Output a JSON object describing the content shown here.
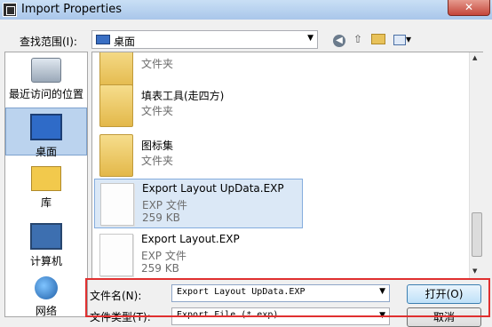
{
  "window": {
    "title": "Import Properties",
    "close_label": "✕"
  },
  "lookin": {
    "label": "查找范围(I):",
    "value": "桌面"
  },
  "toolbar": {
    "back_icon": "back-arrow-icon",
    "up_icon": "up-folder-icon",
    "new_icon": "new-folder-icon",
    "views_icon": "views-menu-icon"
  },
  "places": [
    {
      "label": "最近访问的位置",
      "icon": "recent-places-icon"
    },
    {
      "label": "桌面",
      "icon": "desktop-icon",
      "selected": true
    },
    {
      "label": "库",
      "icon": "libraries-icon"
    },
    {
      "label": "计算机",
      "icon": "computer-icon"
    },
    {
      "label": "网络",
      "icon": "network-icon"
    }
  ],
  "files": [
    {
      "name": "",
      "type": "文件夹",
      "size": "",
      "kind": "folder"
    },
    {
      "name": "填表工具(走四方)",
      "type": "文件夹",
      "size": "",
      "kind": "folder"
    },
    {
      "name": "图标集",
      "type": "文件夹",
      "size": "",
      "kind": "folder"
    },
    {
      "name": "Export Layout UpData.EXP",
      "type": "EXP 文件",
      "size": "259 KB",
      "kind": "file",
      "selected": true
    },
    {
      "name": "Export Layout.EXP",
      "type": "EXP 文件",
      "size": "259 KB",
      "kind": "file"
    }
  ],
  "filename": {
    "label": "文件名(N):",
    "value": "Export Layout UpData.EXP"
  },
  "filetype": {
    "label": "文件类型(T):",
    "value": "Export File (*.exp)"
  },
  "buttons": {
    "open": "打开(O)",
    "cancel": "取消"
  },
  "colors": {
    "highlight": "#e03030",
    "selection": "#dbe8f6"
  }
}
